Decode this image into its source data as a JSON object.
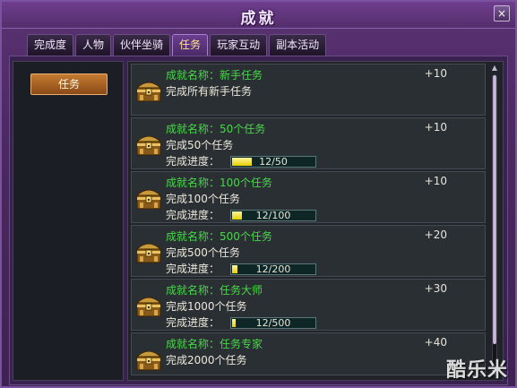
{
  "window": {
    "title": "成就",
    "close_label": "×"
  },
  "tabs": [
    {
      "label": "完成度",
      "active": false
    },
    {
      "label": "人物",
      "active": false
    },
    {
      "label": "伙伴坐骑",
      "active": false
    },
    {
      "label": "任务",
      "active": true
    },
    {
      "label": "玩家互动",
      "active": false
    },
    {
      "label": "副本活动",
      "active": false
    }
  ],
  "category": {
    "selected_label": "任务"
  },
  "achievements": [
    {
      "name": "成就名称：新手任务",
      "points": "+10",
      "desc": "完成所有新手任务",
      "progress_label": "",
      "progress_text": "",
      "progress_fraction": 0
    },
    {
      "name": "成就名称：50个任务",
      "points": "+10",
      "desc": "完成50个任务",
      "progress_label": "完成进度：",
      "progress_text": "12/50",
      "progress_fraction": 0.24
    },
    {
      "name": "成就名称：100个任务",
      "points": "+10",
      "desc": "完成100个任务",
      "progress_label": "完成进度：",
      "progress_text": "12/100",
      "progress_fraction": 0.12
    },
    {
      "name": "成就名称：500个任务",
      "points": "+20",
      "desc": "完成500个任务",
      "progress_label": "完成进度：",
      "progress_text": "12/200",
      "progress_fraction": 0.06
    },
    {
      "name": "成就名称：任务大师",
      "points": "+30",
      "desc": "完成1000个任务",
      "progress_label": "完成进度：",
      "progress_text": "12/500",
      "progress_fraction": 0.024
    },
    {
      "name": "成就名称：任务专家",
      "points": "+40",
      "desc": "完成2000个任务",
      "progress_label": "",
      "progress_text": "",
      "progress_fraction": 0
    }
  ],
  "scrollbar": {
    "up_glyph": "▲",
    "down_glyph": "▼"
  },
  "watermark": "酷乐米",
  "colors": {
    "name_green": "#4ad64a",
    "progress_yellow": "#e8d000",
    "accent_purple": "#5a3272"
  }
}
